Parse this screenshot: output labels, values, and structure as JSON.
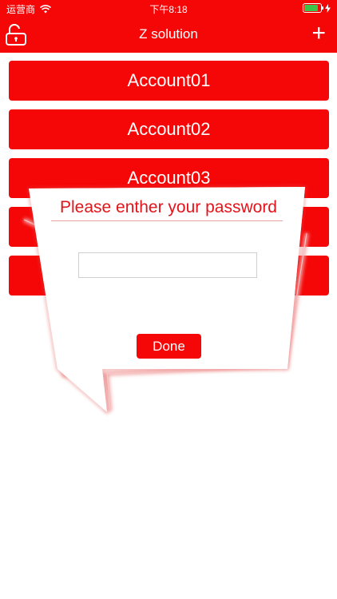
{
  "status_bar": {
    "carrier": "运营商",
    "time": "下午8:18"
  },
  "nav": {
    "title": "Z solution",
    "add_label": "+"
  },
  "accounts": [
    "Account01",
    "Account02",
    "Account03"
  ],
  "dialog": {
    "title": "Please enther your password",
    "password_value": "",
    "done_label": "Done"
  },
  "colors": {
    "accent": "#f50607",
    "battery": "#3ec34a"
  }
}
